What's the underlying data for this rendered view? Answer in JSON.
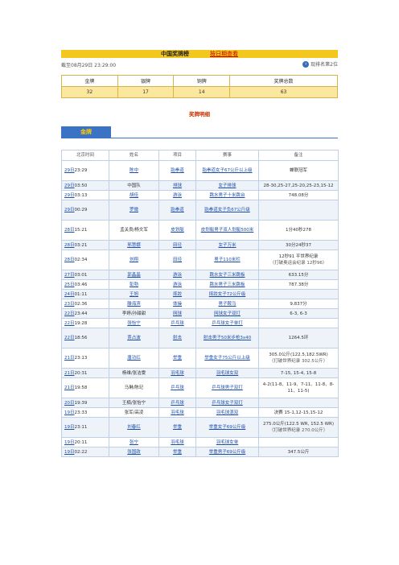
{
  "header": {
    "title": "中国奖牌榜",
    "link": "按日期查看",
    "as_of": "截至08月29日 23:29:00",
    "rank": "现排名第2位"
  },
  "medal_summary": {
    "headers": [
      "金牌",
      "银牌",
      "铜牌",
      "奖牌总数"
    ],
    "values": [
      "32",
      "17",
      "14",
      "63"
    ]
  },
  "detail_title": "奖牌明细",
  "gold_tab": "金牌",
  "events_table": {
    "headers": [
      "北京时间",
      "姓名",
      "项目",
      "赛事",
      "备注"
    ],
    "rows": [
      {
        "day": "29日",
        "time": "23:29",
        "name": "陈中",
        "sport": "跆拳道",
        "event": "跆拳道女子67公斤以上级",
        "note": "蝉联冠军",
        "note2": "",
        "name_link": true,
        "sport_link": true,
        "h": 25
      },
      {
        "day": "29日",
        "time": "03:50",
        "name": "中国队",
        "sport": "排球",
        "event": "女子排球",
        "note": "28-30,25-27,25-20,25-23,15-12",
        "note2": "",
        "name_link": false,
        "sport_link": true,
        "h": 12
      },
      {
        "day": "29日",
        "time": "03:13",
        "name": "胡佳",
        "sport": "游泳",
        "event": "跳水男子十米跳台",
        "note": "748.08分",
        "note2": "",
        "name_link": true,
        "sport_link": true,
        "h": 12
      },
      {
        "day": "29日",
        "time": "00:29",
        "name": "罗微",
        "sport": "跆拳道",
        "event": "跆拳道女子负67公斤级",
        "note": "",
        "note2": "",
        "name_link": true,
        "sport_link": true,
        "h": 25
      },
      {
        "day": "28日",
        "time": "15:21",
        "name": "孟关良/杨文军",
        "sport": "皮划艇",
        "event": "皮划艇男子双人划艇500米",
        "note": "1分40秒278",
        "note2": "",
        "name_link": false,
        "sport_link": true,
        "h": 25
      },
      {
        "day": "28日",
        "time": "03:21",
        "name": "邢慧娜",
        "sport": "田径",
        "event": "女子万米",
        "note": "30分24秒37",
        "note2": "",
        "name_link": true,
        "sport_link": true,
        "h": 12
      },
      {
        "day": "28日",
        "time": "02:34",
        "name": "刘翔",
        "sport": "田径",
        "event": "男子110米栏",
        "note": "12秒91 平世界纪录",
        "note2": "（打破奥运会纪录 12秒96）",
        "name_link": true,
        "sport_link": true,
        "h": 25
      },
      {
        "day": "27日",
        "time": "03:01",
        "name": "郭晶晶",
        "sport": "游泳",
        "event": "跳水女子三米跳板",
        "note": "633.15分",
        "note2": "",
        "name_link": true,
        "sport_link": true,
        "h": 12
      },
      {
        "day": "25日",
        "time": "03:46",
        "name": "彭勃",
        "sport": "游泳",
        "event": "跳水男子三米跳板",
        "note": "787.38分",
        "note2": "",
        "name_link": true,
        "sport_link": true,
        "h": 12
      },
      {
        "day": "24日",
        "time": "01:11",
        "name": "王旭",
        "sport": "摔跤",
        "event": "摔跤女子72公斤级",
        "note": "",
        "note2": "",
        "name_link": true,
        "sport_link": true,
        "h": 12
      },
      {
        "day": "23日",
        "time": "02:36",
        "name": "滕海滨",
        "sport": "体操",
        "event": "男子鞍马",
        "note": "9.837分",
        "note2": "",
        "name_link": true,
        "sport_link": true,
        "h": 12
      },
      {
        "day": "22日",
        "time": "23:44",
        "name": "李婷/孙甜甜",
        "sport": "网球",
        "event": "网球女子双打",
        "note": "6-3, 6-3",
        "note2": "",
        "name_link": false,
        "sport_link": true,
        "h": 12
      },
      {
        "day": "22日",
        "time": "19:28",
        "name": "张怡宁",
        "sport": "乒乓球",
        "event": "乒乓球女子单打",
        "note": "",
        "note2": "",
        "name_link": true,
        "sport_link": true,
        "h": 12
      },
      {
        "day": "22日",
        "time": "18:56",
        "name": "贾占波",
        "sport": "射击",
        "event": "射击男子50米步枪3x40",
        "note": "1264.5环",
        "note2": "",
        "name_link": true,
        "sport_link": true,
        "h": 25
      },
      {
        "day": "21日",
        "time": "23:13",
        "name": "唐功红",
        "sport": "举重",
        "event": "举重女子75公斤以上级",
        "note": "305.0公斤(122.5,182.5WR)",
        "note2": "（打破世界纪录 302.5公斤）",
        "name_link": true,
        "sport_link": true,
        "h": 25
      },
      {
        "day": "21日",
        "time": "20:31",
        "name": "杨维/张洁雯",
        "sport": "羽毛球",
        "event": "羽毛球女双",
        "note": "7-15, 15-4, 15-8",
        "note2": "",
        "name_link": false,
        "sport_link": true,
        "h": 12
      },
      {
        "day": "21日",
        "time": "19:58",
        "name": "马琳/陈玘",
        "sport": "乒乓球",
        "event": "乒乓球男子双打",
        "note": "4-2(11-8、11-9、7-11、11-8、8-11、11-5)",
        "note2": "",
        "name_link": false,
        "sport_link": true,
        "h": 25
      },
      {
        "day": "20日",
        "time": "19:39",
        "name": "王楠/张怡宁",
        "sport": "乒乓球",
        "event": "乒乓球女子双打",
        "note": "",
        "note2": "",
        "name_link": false,
        "sport_link": true,
        "h": 12
      },
      {
        "day": "19日",
        "time": "23:33",
        "name": "张军/高凌",
        "sport": "羽毛球",
        "event": "羽毛球混双",
        "note": "决赛 15-1,12-15,15-12",
        "note2": "",
        "name_link": false,
        "sport_link": true,
        "h": 12
      },
      {
        "day": "19日",
        "time": "23:11",
        "name": "刘春红",
        "sport": "举重",
        "event": "举重女子69公斤级",
        "note": "275.0公斤(122.5 WR, 152.5 WR)",
        "note2": "（打破世界纪录 270.0公斤）",
        "name_link": true,
        "sport_link": true,
        "h": 25
      },
      {
        "day": "19日",
        "time": "20:11",
        "name": "张宁",
        "sport": "羽毛球",
        "event": "羽毛球女单",
        "note": "",
        "note2": "",
        "name_link": true,
        "sport_link": true,
        "h": 12
      },
      {
        "day": "19日",
        "time": "02:22",
        "name": "张国政",
        "sport": "举重",
        "event": "举重男子69公斤级",
        "note": "347.5公斤",
        "note2": "",
        "name_link": true,
        "sport_link": true,
        "h": 12
      }
    ]
  }
}
